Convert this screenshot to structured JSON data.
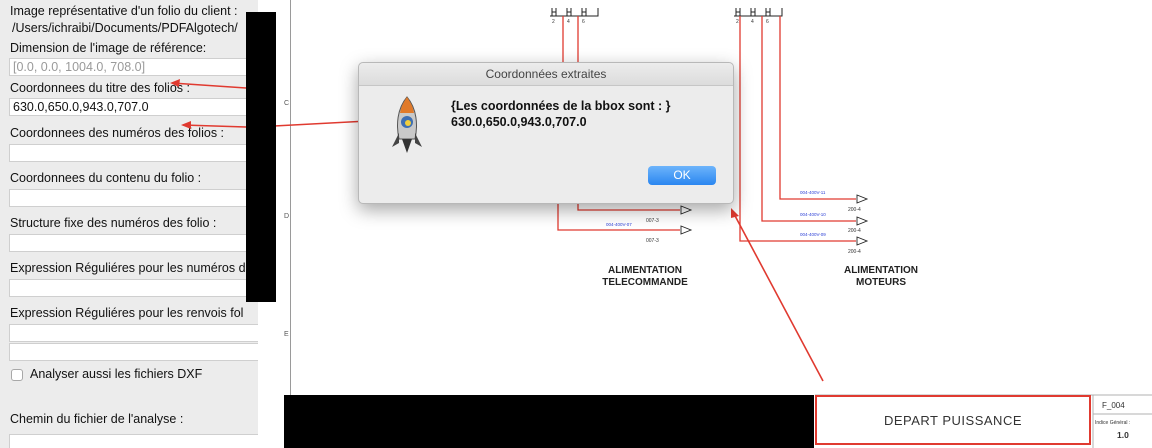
{
  "form": {
    "folio_image_label": "Image représentative d'un folio du client :",
    "folio_image_path": "/Users/ichraibi/Documents/PDFAlgotech/",
    "reference_dimension_label": "Dimension de l'image de référence:",
    "reference_dimension_value": "[0.0, 0.0, 1004.0, 708.0]",
    "title_coords_label": "Coordonnees du titre des folios :",
    "title_coords_value": "630.0,650.0,943.0,707.0",
    "numbers_coords_label": "Coordonnees des numéros des folios :",
    "content_coords_label": "Coordonnees du contenu du folio :",
    "fixed_structure_label": "Structure fixe des numéros des folio :",
    "regex_numbers_label": "Expression Réguliéres pour les numéros d",
    "regex_refs_label": "Expression Réguliéres pour les renvois fol",
    "analyze_dxf_label": "Analyser aussi les fichiers DXF",
    "analysis_path_label": "Chemin du fichier de l'analyse :"
  },
  "dialog": {
    "title": "Coordonnées extraites",
    "message_line1": "{Les coordonnées de la bbox sont : }",
    "message_line2": "630.0,650.0,943.0,707.0",
    "ok_label": "OK"
  },
  "drawing": {
    "zone_letters": [
      "C",
      "D",
      "E"
    ],
    "caption_left_1": "ALIMENTATION",
    "caption_left_2": "TELECOMMANDE",
    "caption_right_1": "ALIMENTATION",
    "caption_right_2": "MOTEURS",
    "wire_tags_left": [
      "004-400V-08",
      "004-400V-07"
    ],
    "refs_left": [
      "007-3",
      "007-3"
    ],
    "wire_tags_right": [
      "004-400V-11",
      "004-400V-10",
      "004-400V-09"
    ],
    "refs_right": [
      "200-4",
      "200-4",
      "200-4"
    ],
    "terminal_numbers": [
      "2",
      "4",
      "6"
    ],
    "title_block": {
      "main_title": "DEPART PUISSANCE",
      "folio_number": "F_004",
      "indice_label": "Indice Général :",
      "version": "1.0"
    }
  },
  "colors": {
    "annotation_red": "#e03a30",
    "ok_blue": "#2a86f0",
    "wire_tag_blue": "#2b3fd6"
  }
}
